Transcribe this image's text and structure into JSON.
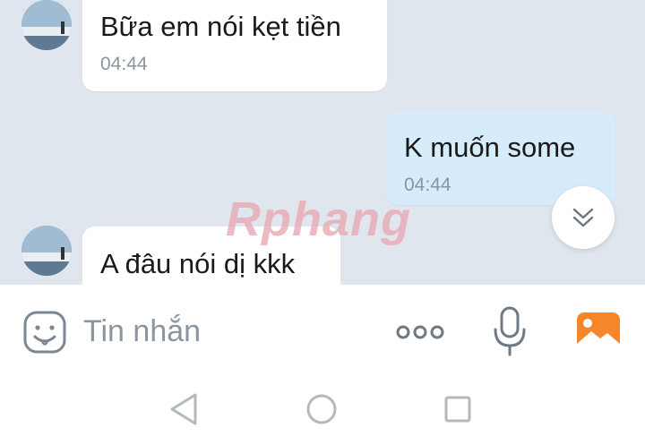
{
  "messages": [
    {
      "direction": "incoming",
      "text": "Bữa em nói kẹt tiền",
      "time": "04:44"
    },
    {
      "direction": "outgoing",
      "text": "K muốn some",
      "time": "04:44"
    },
    {
      "direction": "incoming",
      "text": "A đâu nói dị kkk",
      "time": ""
    }
  ],
  "watermark": "Rphang",
  "composer": {
    "placeholder": "Tin nhắn",
    "icons": [
      "sticker-icon",
      "more-icon",
      "microphone-icon",
      "image-icon"
    ]
  },
  "navigation": {
    "icons": [
      "back-icon",
      "home-icon",
      "recents-icon"
    ]
  },
  "colors": {
    "chat_background": "#dfe6ee",
    "incoming_bubble": "#ffffff",
    "outgoing_bubble": "#d6ecfb",
    "time_text": "#8c949c",
    "image_icon_accent": "#f5872a"
  }
}
